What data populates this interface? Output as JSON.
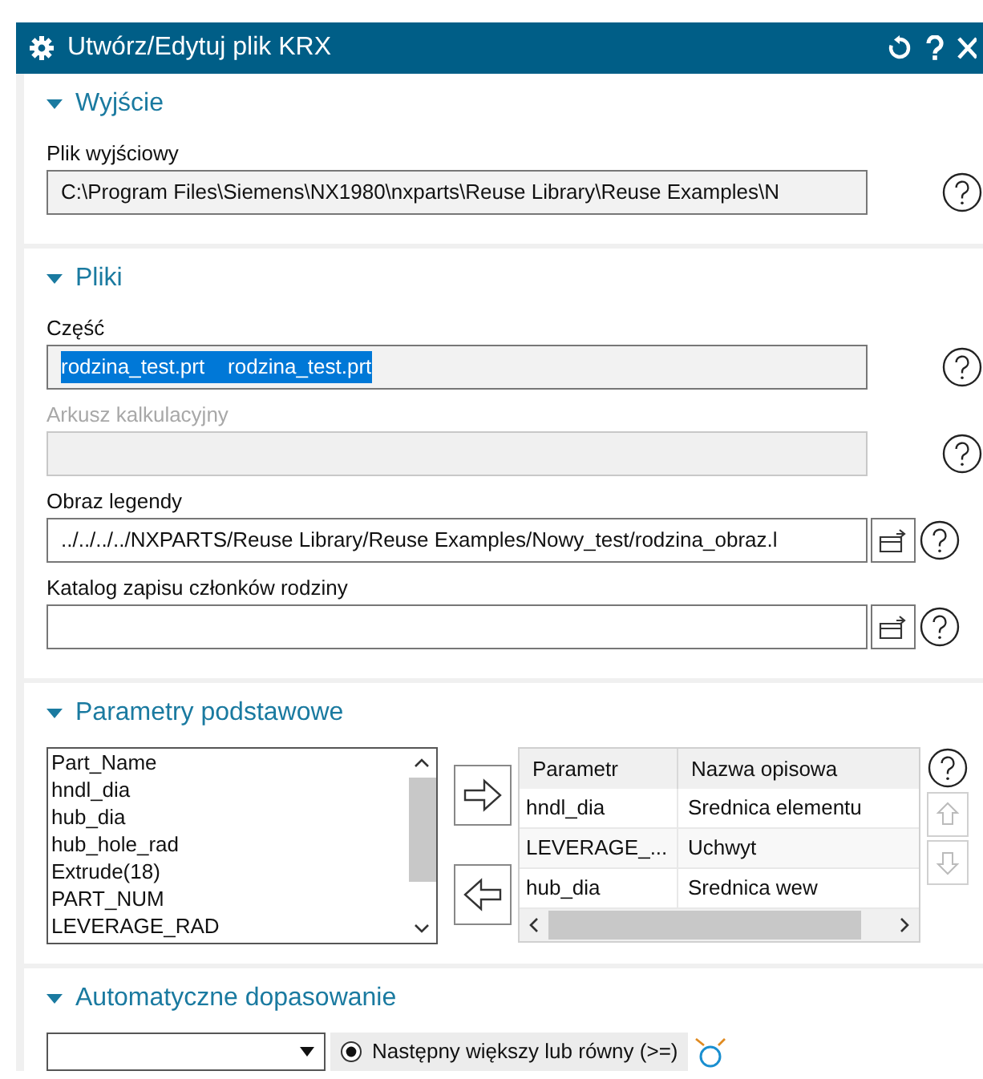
{
  "window": {
    "title": "Utwórz/Edytuj plik KRX"
  },
  "sections": [
    {
      "title": "Wyjście",
      "expanded": true,
      "kind": "fields",
      "fields": [
        {
          "label": "Plik wyjściowy",
          "value": "C:\\Program Files\\Siemens\\NX1980\\nxparts\\Reuse Library\\Reuse Examples\\N",
          "disabled": false,
          "browse": false,
          "text_selected": false
        }
      ]
    },
    {
      "title": "Pliki",
      "expanded": true,
      "kind": "fields",
      "fields": [
        {
          "label": "Część",
          "value": "rodzina_test.prt    rodzina_test.prt",
          "disabled": false,
          "browse": false,
          "text_selected": true
        },
        {
          "label": "Arkusz kalkulacyjny",
          "disabled": true,
          "browse": false
        },
        {
          "label": "Obraz legendy",
          "value": "../../../../NXPARTS/Reuse Library/Reuse Examples/Nowy_test/rodzina_obraz.l",
          "disabled": false,
          "browse": true,
          "text_selected": false
        },
        {
          "label": "Katalog zapisu członków rodziny",
          "disabled": false,
          "browse": true
        }
      ]
    },
    {
      "title": "Parametry podstawowe",
      "expanded": true,
      "kind": "params",
      "list": [
        "Part_Name",
        "hndl_dia",
        "hub_dia",
        "hub_hole_rad",
        "Extrude(18)",
        "PART_NUM",
        "LEVERAGE_RAD"
      ],
      "table": {
        "columns": [
          "Parametr",
          "Nazwa opisowa"
        ],
        "rows": [
          [
            "hndl_dia",
            "Srednica elementu"
          ],
          [
            "LEVERAGE_...",
            "Uchwyt"
          ],
          [
            "hub_dia",
            "Srednica wew"
          ]
        ]
      }
    },
    {
      "title": "Automatyczne dopasowanie",
      "expanded": true,
      "kind": "match",
      "radio": {
        "label": "Następny większy lub równy (>=)",
        "checked": true
      }
    }
  ]
}
